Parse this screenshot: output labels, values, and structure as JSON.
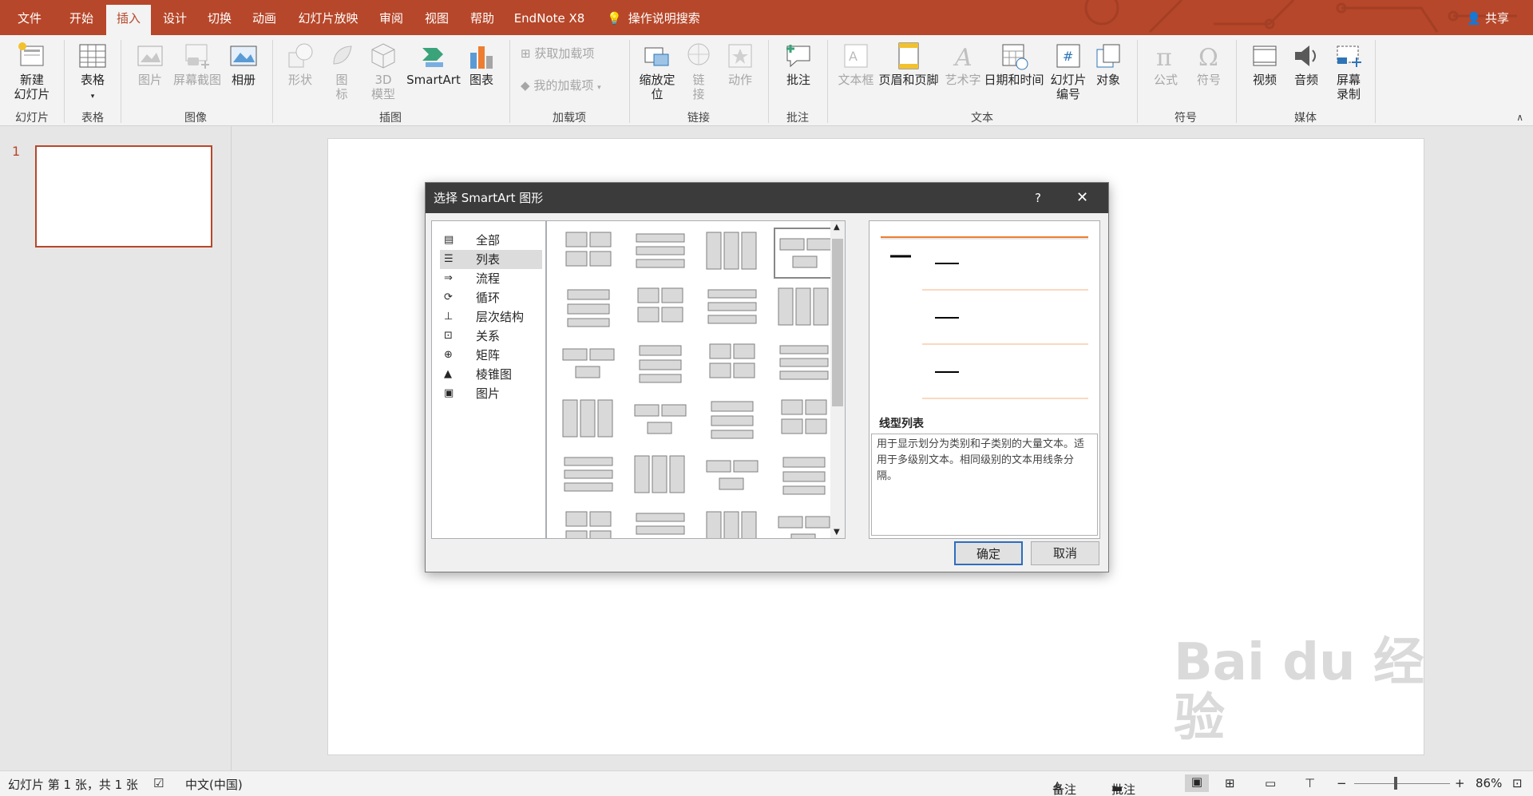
{
  "tabs": [
    "文件",
    "开始",
    "插入",
    "设计",
    "切换",
    "动画",
    "幻灯片放映",
    "审阅",
    "视图",
    "帮助",
    "EndNote X8",
    "操作说明搜索"
  ],
  "share": "共享",
  "ribbon": {
    "new_slide": "新建\n幻灯片",
    "table": "表格",
    "pictures": "图片",
    "screenshot": "屏幕截图",
    "album": "相册",
    "shapes": "形状",
    "icons": "图\n标",
    "model3d": "3D\n模型",
    "smartart": "SmartArt",
    "chart": "图表",
    "get_addins": "获取加载项",
    "my_addins": "我的加载项",
    "zoom": "缩放定\n位",
    "link": "链\n接",
    "action": "动作",
    "comment": "批注",
    "textbox": "文本框",
    "header_footer": "页眉和页脚",
    "wordart": "艺术字",
    "datetime": "日期和时间",
    "slide_number": "幻灯片\n编号",
    "object": "对象",
    "equation": "公式",
    "symbol": "符号",
    "video": "视频",
    "audio": "音频",
    "screen_rec": "屏幕\n录制",
    "groups": [
      "幻灯片",
      "表格",
      "图像",
      "插图",
      "加载项",
      "链接",
      "批注",
      "文本",
      "符号",
      "媒体"
    ]
  },
  "slide_number": "1",
  "dialog": {
    "title": "选择 SmartArt 图形",
    "help": "?",
    "categories": [
      "全部",
      "列表",
      "流程",
      "循环",
      "层次结构",
      "关系",
      "矩阵",
      "棱锥图",
      "图片"
    ],
    "selected_category": "列表",
    "preview_name": "线型列表",
    "preview_desc": "用于显示划分为类别和子类别的大量文本。适用于多级别文本。相同级别的文本用线条分隔。",
    "ok": "确定",
    "cancel": "取消"
  },
  "status": {
    "slide_info": "幻灯片 第 1 张，共 1 张",
    "language": "中文(中国)",
    "notes": "备注",
    "comments": "批注",
    "zoom_minus": "−",
    "zoom_plus": "+",
    "zoom_level": "86%",
    "zoom_fraction": 0.43
  },
  "watermark": "Baidu经验  jingyan.baidu.com",
  "colors": {
    "accent": "#b7472a",
    "ribbon_bg": "#f3f3f3"
  }
}
